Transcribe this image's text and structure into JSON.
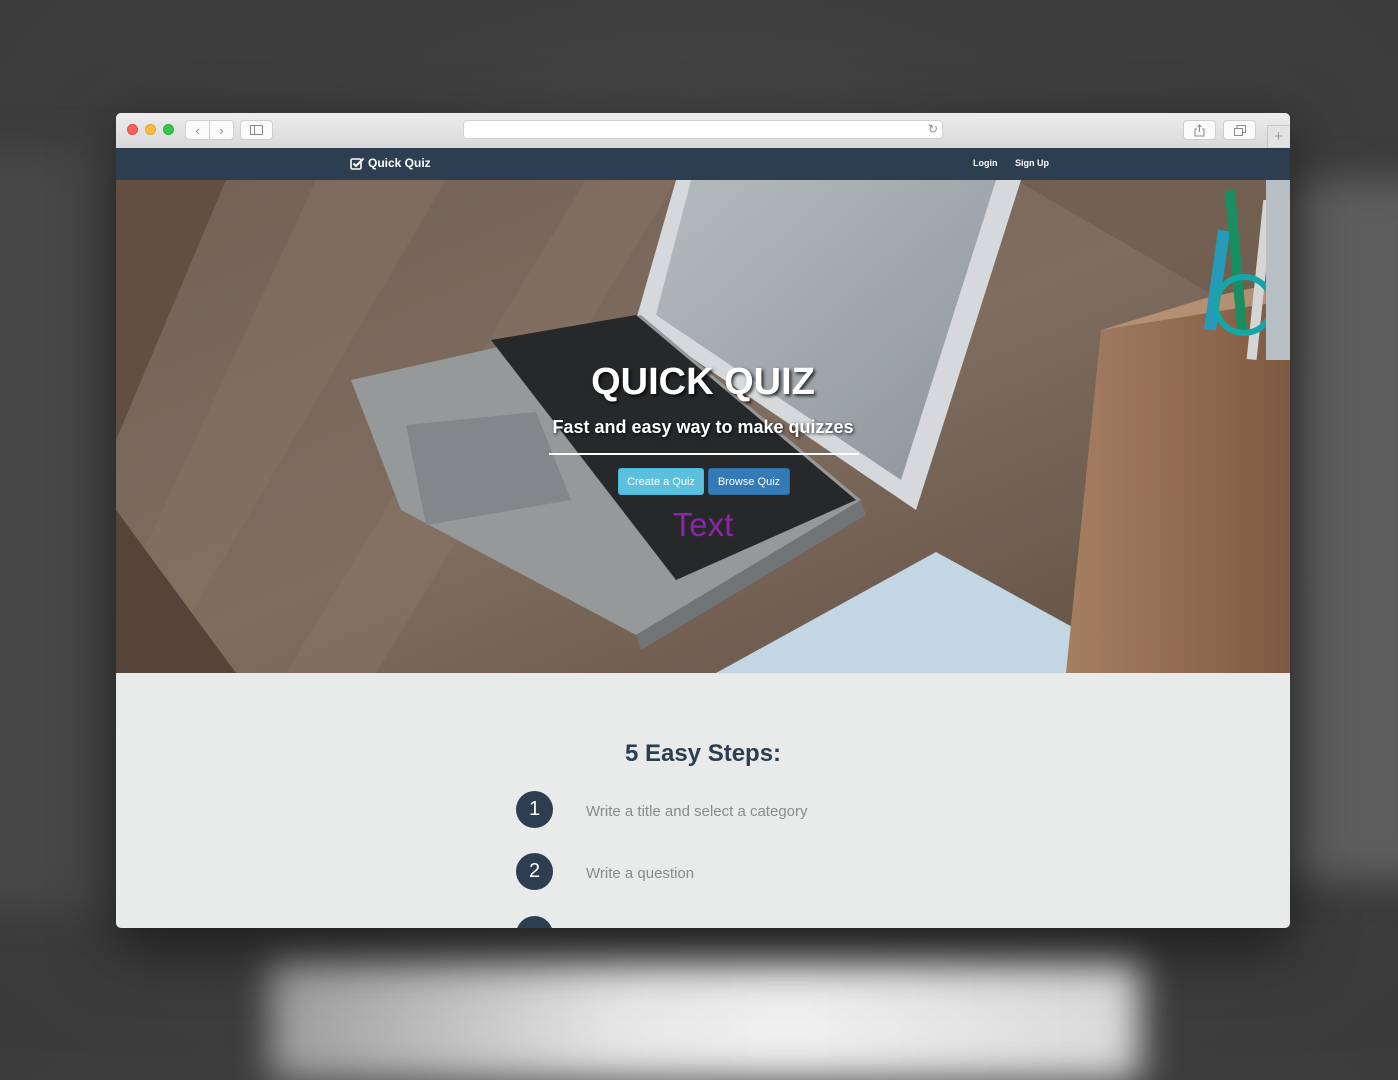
{
  "navbar": {
    "brand": "Quick Quiz",
    "login": "Login",
    "signup": "Sign Up"
  },
  "hero": {
    "title": "QUICK QUIZ",
    "subtitle": "Fast and easy way to make quizzes",
    "create_button": "Create a Quiz",
    "browse_button": "Browse Quiz",
    "placeholder_text": "Text"
  },
  "steps": {
    "title": "5 Easy Steps:",
    "items": [
      {
        "number": "1",
        "text": "Write a title and select a category"
      },
      {
        "number": "2",
        "text": "Write a question"
      }
    ]
  },
  "colors": {
    "navbar": "#2c3e50",
    "create_button": "#5bc0de",
    "browse_button": "#337ab7",
    "placeholder_text": "#8e24aa",
    "section_bg": "#e9eaea"
  },
  "icons": {
    "brand": "check-square-icon",
    "back": "chevron-left-icon",
    "forward": "chevron-right-icon",
    "sidebar": "sidebar-icon",
    "reload": "reload-icon",
    "share": "share-icon",
    "tabs": "tabs-icon",
    "new_tab": "plus-icon"
  }
}
